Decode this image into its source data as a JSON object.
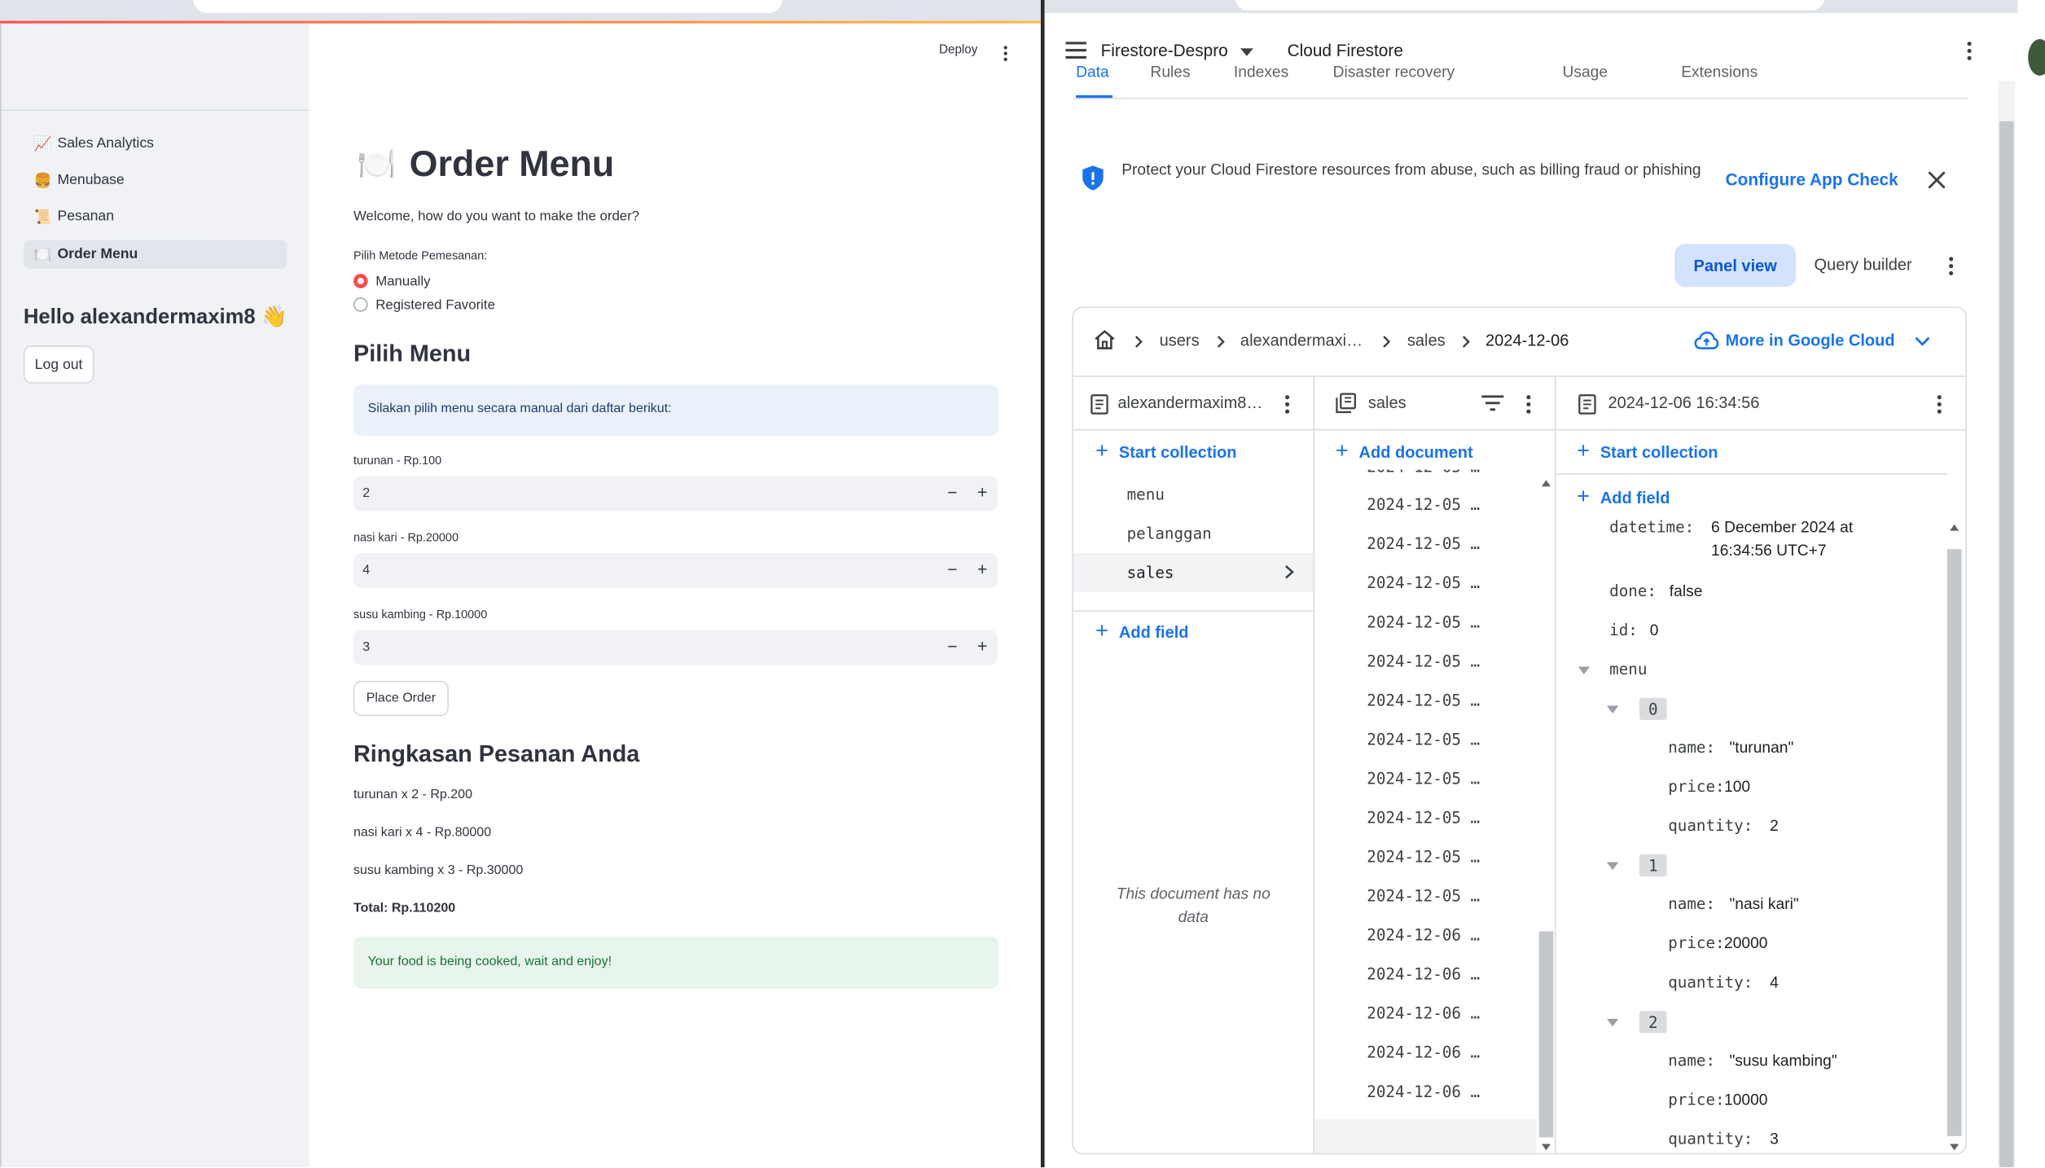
{
  "streamlit": {
    "header": {
      "deploy_label": "Deploy"
    },
    "sidebar": {
      "nav": [
        {
          "emoji": "📈",
          "label": "Sales Analytics"
        },
        {
          "emoji": "🍔",
          "label": "Menubase"
        },
        {
          "emoji": "📜",
          "label": "Pesanan"
        },
        {
          "emoji": "🍽️",
          "label": "Order Menu",
          "active": true
        }
      ],
      "greeting": "Hello alexandermaxim8 👋",
      "logout_label": "Log out"
    },
    "main": {
      "title_emoji": "🍽️",
      "title": "Order Menu",
      "welcome": "Welcome, how do you want to make the order?",
      "method_label": "Pilih Metode Pemesanan:",
      "methods": [
        {
          "label": "Manually",
          "selected": true
        },
        {
          "label": "Registered Favorite",
          "selected": false
        }
      ],
      "pilih_menu_heading": "Pilih Menu",
      "info_text": "Silakan pilih menu secara manual dari daftar berikut:",
      "items": [
        {
          "label": "turunan - Rp.100",
          "value": "2"
        },
        {
          "label": "nasi kari - Rp.20000",
          "value": "4"
        },
        {
          "label": "susu kambing - Rp.10000",
          "value": "3"
        }
      ],
      "stepper_minus": "−",
      "stepper_plus": "+",
      "place_order_label": "Place Order",
      "summary_heading": "Ringkasan Pesanan Anda",
      "summary_lines": [
        "turunan x 2 - Rp.200",
        "nasi kari x 4 - Rp.80000",
        "susu kambing x 3 - Rp.30000"
      ],
      "total": "Total: Rp.110200",
      "success": "Your food is being cooked, wait and enjoy!"
    }
  },
  "firestore": {
    "project": "Firestore-Despro",
    "product": "Cloud Firestore",
    "tabs": [
      "Data",
      "Rules",
      "Indexes",
      "Disaster recovery",
      "Usage",
      "Extensions"
    ],
    "banner": {
      "text": "Protect your Cloud Firestore resources from abuse, such as billing fraud or phishing",
      "action": "Configure App Check"
    },
    "view_toggle": {
      "panel": "Panel view",
      "query": "Query builder"
    },
    "breadcrumb": [
      "users",
      "alexandermaxi…",
      "sales",
      "2024-12-06"
    ],
    "more_cloud": "More in Google Cloud",
    "col1": {
      "header": "alexandermaxim8…",
      "start_collection": "Start collection",
      "collections": [
        "menu",
        "pelanggan",
        "sales"
      ],
      "add_field": "Add field",
      "empty_note": "This document has no data"
    },
    "col2": {
      "header": "sales",
      "add_document": "Add document",
      "documents": [
        "2024-12-05 …",
        "2024-12-05 …",
        "2024-12-05 …",
        "2024-12-05 …",
        "2024-12-05 …",
        "2024-12-05 …",
        "2024-12-05 …",
        "2024-12-05 …",
        "2024-12-05 …",
        "2024-12-05 …",
        "2024-12-05 …",
        "2024-12-06 …",
        "2024-12-06 …",
        "2024-12-06 …",
        "2024-12-06 …",
        "2024-12-06 …",
        "2024-12-06 …"
      ],
      "partial_top": "2024-12-05 …"
    },
    "col3": {
      "header": "2024-12-06 16:34:56",
      "start_collection": "Start collection",
      "add_field": "Add field",
      "fields": {
        "datetime_key": "datetime:",
        "datetime_val_1": "6 December 2024 at",
        "datetime_val_2": "16:34:56 UTC+7",
        "done_key": "done:",
        "done_val": "false",
        "id_key": "id:",
        "id_val": "0",
        "menu_key": "menu"
      },
      "menu_items": [
        {
          "index": "0",
          "name": "\"turunan\"",
          "price": "100",
          "quantity": "2"
        },
        {
          "index": "1",
          "name": "\"nasi kari\"",
          "price": "20000",
          "quantity": "4"
        },
        {
          "index": "2",
          "name": "\"susu kambing\"",
          "price": "10000",
          "quantity": "3"
        }
      ],
      "k_name": "name:",
      "k_price": "price:",
      "k_quantity": "quantity:"
    }
  },
  "colors": {
    "streamlit_red": "#ff4b4b",
    "google_blue": "#1a73e8",
    "panel_view_bg": "#d3e3fd"
  }
}
